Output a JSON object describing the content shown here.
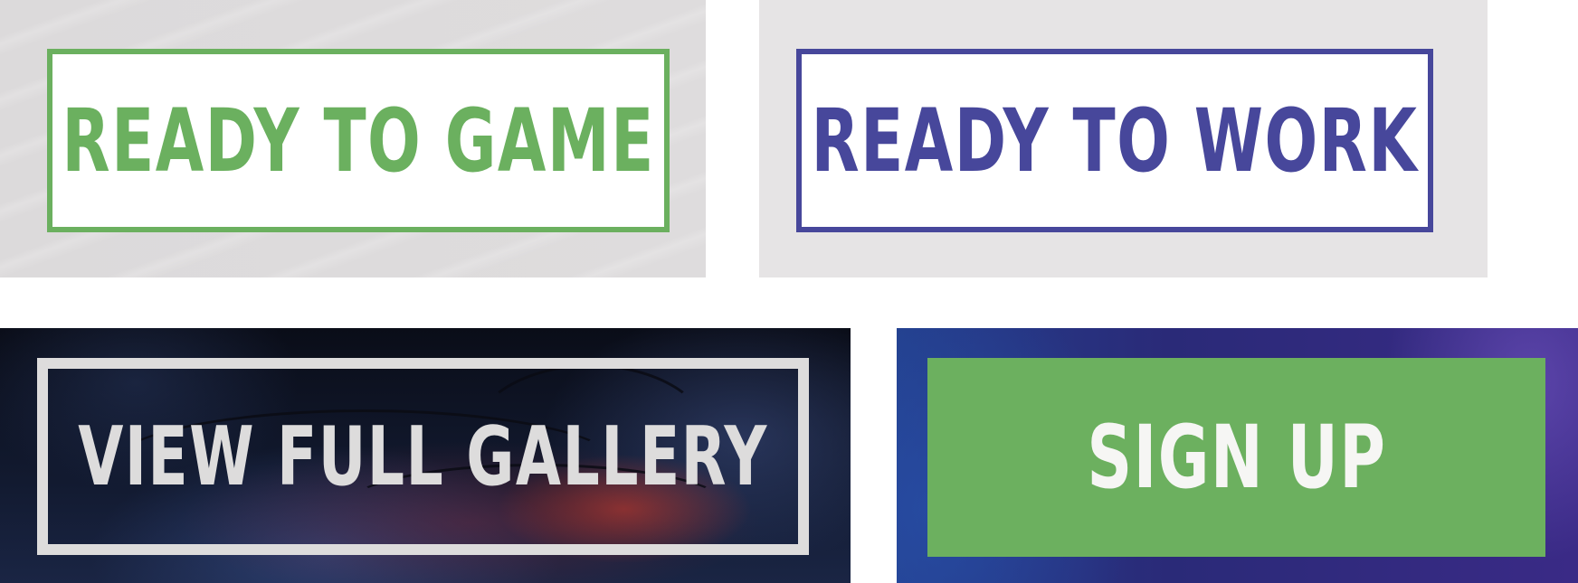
{
  "buttons": {
    "ready_to_game": "READY TO GAME",
    "ready_to_work": "READY TO WORK",
    "view_full_gallery": "VIEW FULL GALLERY",
    "sign_up": "SIGN UP"
  },
  "colors": {
    "game_green": "#6bb05f",
    "work_purple": "#47479b",
    "gallery_light_grey": "#dddcdc",
    "signup_green": "#6cb05f",
    "panel_grey": "#e6e4e5"
  }
}
